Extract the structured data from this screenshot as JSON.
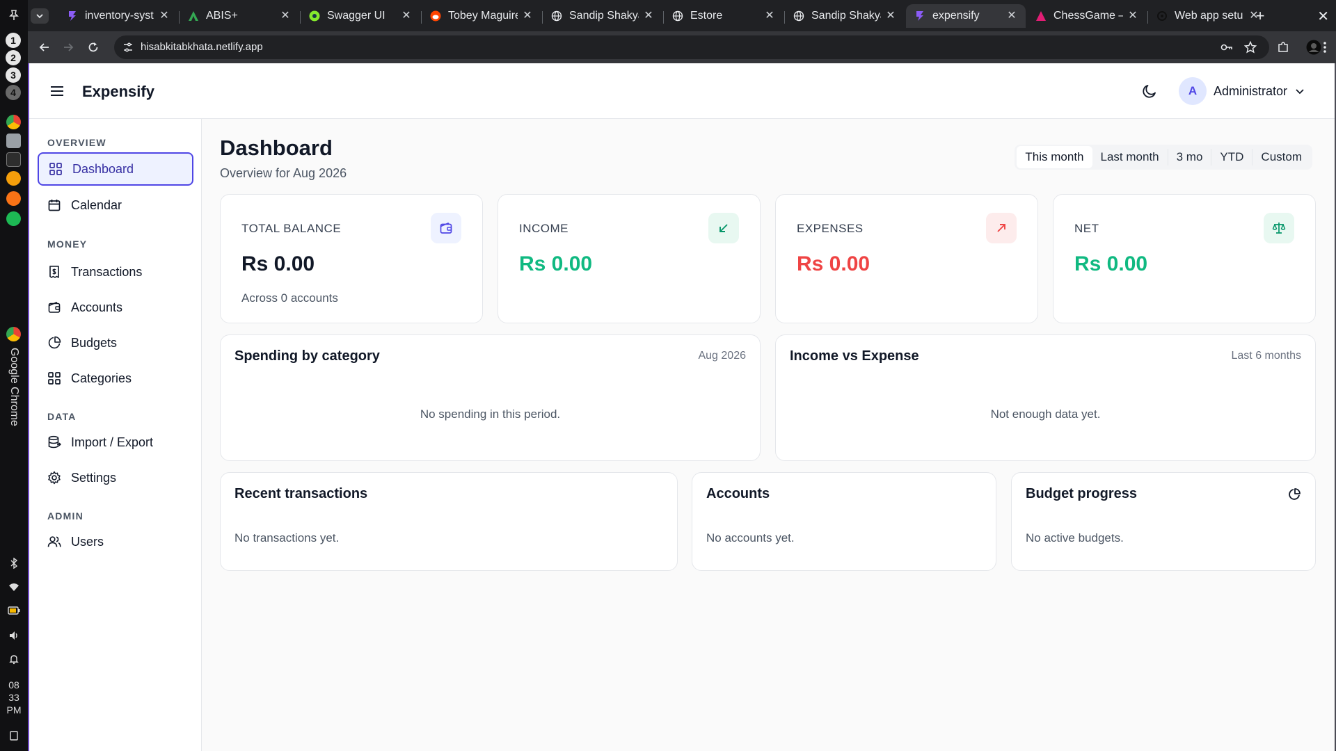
{
  "os": {
    "workspaces": [
      "1",
      "2",
      "3",
      "4"
    ],
    "dock_label": "Google Chrome",
    "clock": [
      "08",
      "33",
      "PM"
    ]
  },
  "browser": {
    "tabs": [
      {
        "title": "inventory-syst",
        "icon": "expensify-logo-icon"
      },
      {
        "title": "ABIS+",
        "icon": "abis-logo-icon"
      },
      {
        "title": "Swagger UI",
        "icon": "swagger-logo-icon"
      },
      {
        "title": "Tobey Maguire",
        "icon": "reddit-logo-icon"
      },
      {
        "title": "Sandip Shakya",
        "icon": "globe-icon"
      },
      {
        "title": "Estore",
        "icon": "globe-icon"
      },
      {
        "title": "Sandip Shakya",
        "icon": "globe-icon"
      },
      {
        "title": "expensify",
        "icon": "expensify-logo-icon",
        "active": true
      },
      {
        "title": "ChessGame –",
        "icon": "chessgame-logo-icon"
      },
      {
        "title": "Web app setu",
        "icon": "openai-logo-icon"
      }
    ],
    "new_tab": "+",
    "close": "✕",
    "url": "hisabkitabkhata.netlify.app"
  },
  "app": {
    "brand": "Expensify",
    "user": {
      "initial": "A",
      "name": "Administrator"
    },
    "sidebar": {
      "sections": [
        {
          "label": "OVERVIEW",
          "items": [
            {
              "label": "Dashboard",
              "icon": "dashboard-icon",
              "active": true
            },
            {
              "label": "Calendar",
              "icon": "calendar-icon"
            }
          ]
        },
        {
          "label": "MONEY",
          "items": [
            {
              "label": "Transactions",
              "icon": "receipt-icon"
            },
            {
              "label": "Accounts",
              "icon": "wallet-icon"
            },
            {
              "label": "Budgets",
              "icon": "pie-chart-icon"
            },
            {
              "label": "Categories",
              "icon": "grid-icon"
            }
          ]
        },
        {
          "label": "DATA",
          "items": [
            {
              "label": "Import / Export",
              "icon": "database-icon"
            },
            {
              "label": "Settings",
              "icon": "gear-icon"
            }
          ]
        },
        {
          "label": "ADMIN",
          "items": [
            {
              "label": "Users",
              "icon": "users-icon"
            }
          ]
        }
      ]
    },
    "page": {
      "title": "Dashboard",
      "subtitle": "Overview for Aug 2026",
      "ranges": [
        "This month",
        "Last month",
        "3 mo",
        "YTD",
        "Custom"
      ],
      "active_range": "This month"
    },
    "kpis": [
      {
        "label": "TOTAL BALANCE",
        "value": "Rs 0.00",
        "note": "Across 0 accounts",
        "icon": "wallet-icon",
        "value_color": "#111827",
        "icon_bg": "#eef2ff",
        "icon_color": "#4f46e5"
      },
      {
        "label": "INCOME",
        "value": "Rs 0.00",
        "note": "",
        "icon": "arrow-down-left-icon",
        "value_color": "#10b981",
        "icon_bg": "#e8f8f1",
        "icon_color": "#059669"
      },
      {
        "label": "EXPENSES",
        "value": "Rs 0.00",
        "note": "",
        "icon": "arrow-up-right-icon",
        "value_color": "#ef4444",
        "icon_bg": "#fdecec",
        "icon_color": "#ef4444"
      },
      {
        "label": "NET",
        "value": "Rs 0.00",
        "note": "",
        "icon": "scale-icon",
        "value_color": "#10b981",
        "icon_bg": "#e8f8f1",
        "icon_color": "#059669"
      }
    ],
    "spending": {
      "title": "Spending by category",
      "meta": "Aug 2026",
      "empty": "No spending in this period."
    },
    "income_vs_expense": {
      "title": "Income vs Expense",
      "meta": "Last 6 months",
      "empty": "Not enough data yet."
    },
    "recent": {
      "title": "Recent transactions",
      "empty": "No transactions yet."
    },
    "accounts": {
      "title": "Accounts",
      "empty": "No accounts yet."
    },
    "budget": {
      "title": "Budget progress",
      "empty": "No active budgets.",
      "icon": "pie-chart-icon"
    }
  }
}
